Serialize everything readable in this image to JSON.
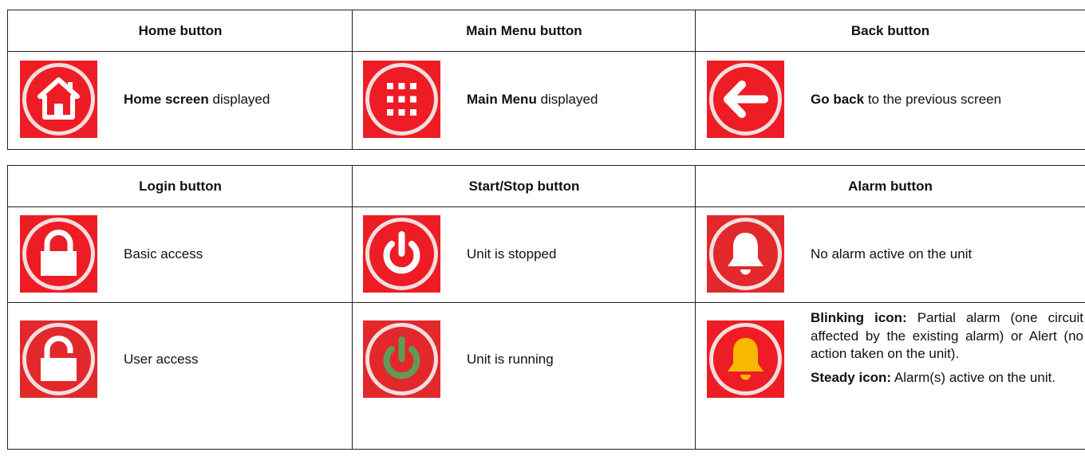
{
  "colors": {
    "icon_red": "#ee1c25",
    "ring": "#f3dede",
    "green": "#5f9b57",
    "amber": "#f7b800",
    "border": "#222222"
  },
  "table1": {
    "headers": [
      "Home button",
      "Main Menu button",
      "Back button"
    ],
    "rows": [
      {
        "home": {
          "icon": "home-icon",
          "bold": "Home screen",
          "text": " displayed"
        },
        "menu": {
          "icon": "grid-menu-icon",
          "bold": "Main Menu",
          "text": " displayed"
        },
        "back": {
          "icon": "arrow-left-icon",
          "bold": "Go back",
          "text": " to the previous screen"
        }
      }
    ]
  },
  "table2": {
    "headers": [
      "Login button",
      "Start/Stop button",
      "Alarm button"
    ],
    "rows": [
      {
        "login": {
          "icon": "lock-closed-icon",
          "text": "Basic access"
        },
        "startstop": {
          "icon": "power-icon",
          "text": "Unit is stopped"
        },
        "alarm": {
          "icon": "bell-white-icon",
          "text": "No alarm active on the unit"
        }
      },
      {
        "login": {
          "icon": "lock-open-icon",
          "text": "User access"
        },
        "startstop": {
          "icon": "power-green-icon",
          "text": "Unit is running"
        },
        "alarm": {
          "icon": "bell-amber-icon",
          "p1_bold": "Blinking icon:",
          "p1_text": " Partial alarm (one circuit affected by the existing alarm) or Alert (no action taken on the unit).",
          "p2_bold": "Steady icon:",
          "p2_text": " Alarm(s) active on the unit."
        }
      }
    ]
  }
}
